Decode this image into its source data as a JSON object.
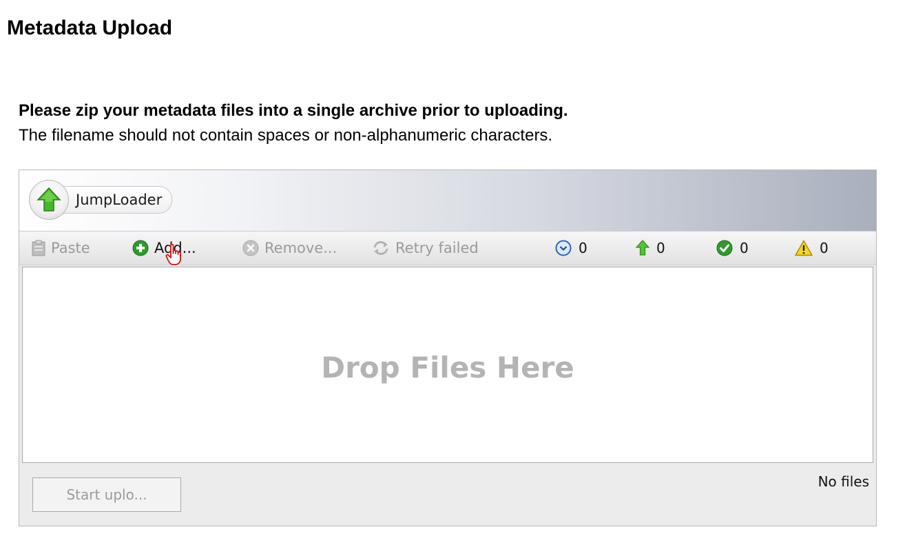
{
  "page": {
    "title": "Metadata Upload",
    "instruction_bold": "Please zip your metadata files into a single archive prior to uploading.",
    "instruction_normal": "The filename should not contain spaces or non-alphanumeric characters."
  },
  "applet": {
    "brand": "JumpLoader",
    "toolbar": {
      "paste_label": "Paste",
      "add_label": "Add...",
      "remove_label": "Remove...",
      "retry_label": "Retry failed"
    },
    "counters": {
      "pending": "0",
      "uploading": "0",
      "done": "0",
      "failed": "0"
    },
    "drop_label": "Drop Files Here",
    "start_label": "Start uplo...",
    "status": "No files"
  },
  "colors": {
    "add_green": "#2e9a2e",
    "brand_arrow": "#47b62b",
    "disabled_text": "#9a9a9a",
    "drop_text": "#b4b4b4"
  },
  "icons": [
    "clipboard-icon",
    "add-icon",
    "remove-icon",
    "retry-icon",
    "clock-icon",
    "up-arrow-icon",
    "check-icon",
    "warning-icon",
    "hand-cursor-icon"
  ]
}
